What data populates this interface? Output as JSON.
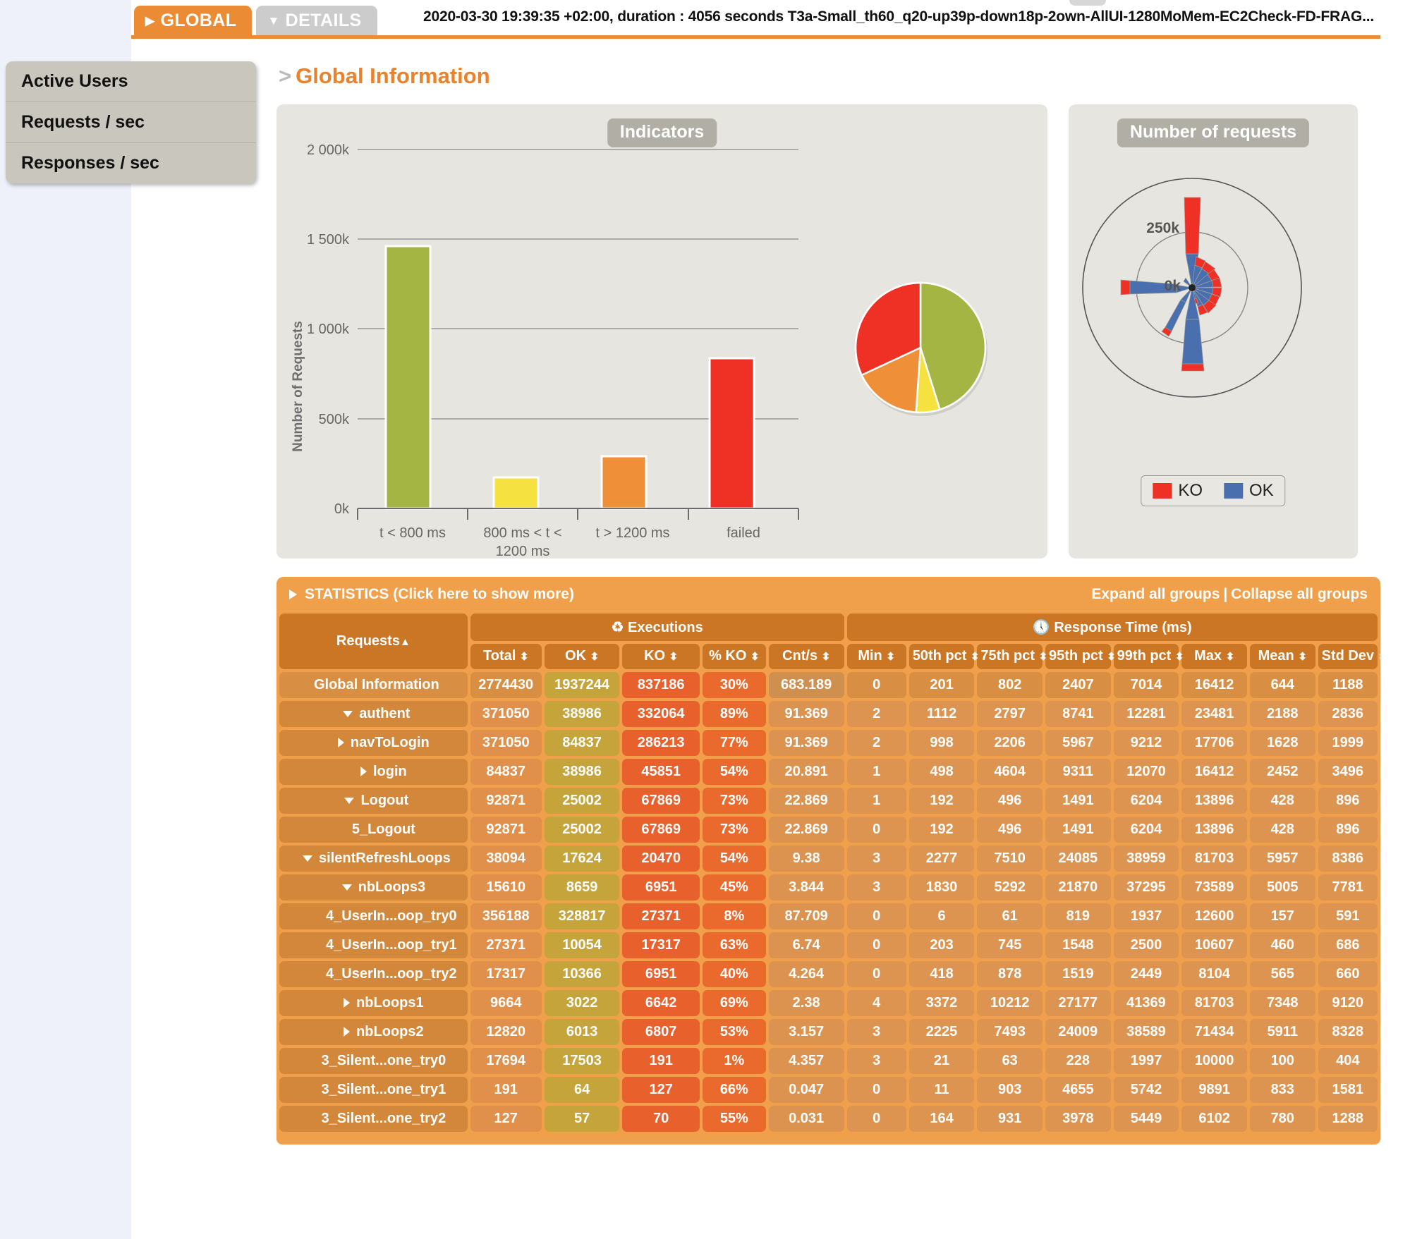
{
  "header": {
    "tabs": [
      {
        "label": "GLOBAL",
        "caret": "▶",
        "active": true
      },
      {
        "label": "DETAILS",
        "caret": "▼",
        "active": false
      }
    ],
    "run_title": "2020-03-30 19:39:35 +02:00, duration : 4056 seconds T3a-Small_th60_q20-up39p-down18p-2own-AllUI-1280MoMem-EC2Check-FD-FRAG..."
  },
  "sidebar": {
    "items": [
      {
        "label": "Active Users"
      },
      {
        "label": "Requests / sec"
      },
      {
        "label": "Responses / sec"
      }
    ]
  },
  "page": {
    "breadcrumb_arrow": ">",
    "title": "Global Information"
  },
  "chart_data": [
    {
      "type": "bar",
      "title": "Indicators",
      "xlabel": "",
      "ylabel": "Number of Requests",
      "categories": [
        "t < 800 ms",
        "800 ms < t < 1200 ms",
        "t > 1200 ms",
        "failed"
      ],
      "values": [
        1462000,
        172000,
        290000,
        837186
      ],
      "colors": [
        "#a4b544",
        "#f5e13f",
        "#ef9038",
        "#ee3124"
      ],
      "ylim": [
        0,
        2000000
      ],
      "yticks": [
        0,
        500000,
        1000000,
        1500000,
        2000000
      ],
      "ytick_labels": [
        "0k",
        "500k",
        "1 000k",
        "1 500k",
        "2 000k"
      ],
      "grid": true,
      "legend": ""
    },
    {
      "type": "pie",
      "title": "",
      "labels": [
        "t < 800 ms",
        "failed",
        "t > 1200 ms",
        "800 ms < t < 1200 ms"
      ],
      "values": [
        53,
        30,
        11,
        6
      ],
      "colors": [
        "#a4b544",
        "#ee3124",
        "#ef9038",
        "#f5e13f"
      ]
    },
    {
      "type": "polar",
      "title": "Number of requests",
      "rticks": [
        0,
        250000
      ],
      "rtick_labels": [
        "0k",
        "250k"
      ],
      "rlim": [
        0,
        500000
      ],
      "legend": [
        "KO",
        "OK"
      ],
      "legend_colors": [
        "#ee3124",
        "#4a6fae"
      ],
      "legend_position": "bottom",
      "series": [
        {
          "name": "OK",
          "color": "#4a6fae",
          "values": [
            12000,
            40000,
            38000,
            36000,
            34000,
            32000,
            30000,
            26000,
            18000,
            9000,
            6000,
            52000,
            140000,
            52000,
            32000,
            20000,
            18000,
            110000,
            14000,
            9000,
            7000,
            6000,
            5000,
            8000
          ]
        },
        {
          "name": "KO",
          "color": "#ee3124",
          "values": [
            4000,
            12000,
            12000,
            12000,
            12000,
            12000,
            12000,
            10000,
            6000,
            3000,
            2000,
            18000,
            195000,
            12000,
            10000,
            8000,
            7000,
            26000,
            5000,
            4000,
            3000,
            3000,
            2000,
            4000
          ]
        }
      ]
    }
  ],
  "statistics": {
    "header_label": "STATISTICS (Click here to show more)",
    "expand_label": "Expand all groups",
    "separator": "|",
    "collapse_label": "Collapse all groups",
    "group_headers": [
      {
        "label": "Executions",
        "icon": "refresh-icon"
      },
      {
        "label": "Response Time (ms)",
        "icon": "clock-icon"
      }
    ],
    "columns": {
      "requests": "Requests",
      "requests_sort": "▲",
      "executions": [
        "Total",
        "OK",
        "KO",
        "% KO",
        "Cnt/s"
      ],
      "response_time": [
        "Min",
        "50th pct",
        "75th pct",
        "95th pct",
        "99th pct",
        "Max",
        "Mean",
        "Std Dev"
      ],
      "sort_glyph": "⬍"
    },
    "rows": [
      {
        "name": "Global Information",
        "indent": 0,
        "toggle": "none",
        "global": true,
        "total": "2774430",
        "ok": "1937244",
        "ko": "837186",
        "pko": "30%",
        "cnt": "683.189",
        "min": "0",
        "p50": "201",
        "p75": "802",
        "p95": "2407",
        "p99": "7014",
        "max": "16412",
        "mean": "644",
        "std": "1188"
      },
      {
        "name": "authent",
        "indent": 0,
        "toggle": "down",
        "total": "371050",
        "ok": "38986",
        "ko": "332064",
        "pko": "89%",
        "cnt": "91.369",
        "min": "2",
        "p50": "1112",
        "p75": "2797",
        "p95": "8741",
        "p99": "12281",
        "max": "23481",
        "mean": "2188",
        "std": "2836"
      },
      {
        "name": "navToLogin",
        "indent": 1,
        "toggle": "right",
        "total": "371050",
        "ok": "84837",
        "ko": "286213",
        "pko": "77%",
        "cnt": "91.369",
        "min": "2",
        "p50": "998",
        "p75": "2206",
        "p95": "5967",
        "p99": "9212",
        "max": "17706",
        "mean": "1628",
        "std": "1999"
      },
      {
        "name": "login",
        "indent": 1,
        "toggle": "right",
        "total": "84837",
        "ok": "38986",
        "ko": "45851",
        "pko": "54%",
        "cnt": "20.891",
        "min": "1",
        "p50": "498",
        "p75": "4604",
        "p95": "9311",
        "p99": "12070",
        "max": "16412",
        "mean": "2452",
        "std": "3496"
      },
      {
        "name": "Logout",
        "indent": 0,
        "toggle": "down",
        "total": "92871",
        "ok": "25002",
        "ko": "67869",
        "pko": "73%",
        "cnt": "22.869",
        "min": "1",
        "p50": "192",
        "p75": "496",
        "p95": "1491",
        "p99": "6204",
        "max": "13896",
        "mean": "428",
        "std": "896"
      },
      {
        "name": "5_Logout",
        "indent": 1,
        "toggle": "none",
        "total": "92871",
        "ok": "25002",
        "ko": "67869",
        "pko": "73%",
        "cnt": "22.869",
        "min": "0",
        "p50": "192",
        "p75": "496",
        "p95": "1491",
        "p99": "6204",
        "max": "13896",
        "mean": "428",
        "std": "896"
      },
      {
        "name": "silentRefreshLoops",
        "indent": 0,
        "toggle": "down",
        "total": "38094",
        "ok": "17624",
        "ko": "20470",
        "pko": "54%",
        "cnt": "9.38",
        "min": "3",
        "p50": "2277",
        "p75": "7510",
        "p95": "24085",
        "p99": "38959",
        "max": "81703",
        "mean": "5957",
        "std": "8386"
      },
      {
        "name": "nbLoops3",
        "indent": 1,
        "toggle": "down",
        "total": "15610",
        "ok": "8659",
        "ko": "6951",
        "pko": "45%",
        "cnt": "3.844",
        "min": "3",
        "p50": "1830",
        "p75": "5292",
        "p95": "21870",
        "p99": "37295",
        "max": "73589",
        "mean": "5005",
        "std": "7781"
      },
      {
        "name": "4_UserIn...oop_try0",
        "indent": 2,
        "toggle": "none",
        "total": "356188",
        "ok": "328817",
        "ko": "27371",
        "pko": "8%",
        "cnt": "87.709",
        "min": "0",
        "p50": "6",
        "p75": "61",
        "p95": "819",
        "p99": "1937",
        "max": "12600",
        "mean": "157",
        "std": "591"
      },
      {
        "name": "4_UserIn...oop_try1",
        "indent": 2,
        "toggle": "none",
        "total": "27371",
        "ok": "10054",
        "ko": "17317",
        "pko": "63%",
        "cnt": "6.74",
        "min": "0",
        "p50": "203",
        "p75": "745",
        "p95": "1548",
        "p99": "2500",
        "max": "10607",
        "mean": "460",
        "std": "686"
      },
      {
        "name": "4_UserIn...oop_try2",
        "indent": 2,
        "toggle": "none",
        "total": "17317",
        "ok": "10366",
        "ko": "6951",
        "pko": "40%",
        "cnt": "4.264",
        "min": "0",
        "p50": "418",
        "p75": "878",
        "p95": "1519",
        "p99": "2449",
        "max": "8104",
        "mean": "565",
        "std": "660"
      },
      {
        "name": "nbLoops1",
        "indent": 1,
        "toggle": "right",
        "total": "9664",
        "ok": "3022",
        "ko": "6642",
        "pko": "69%",
        "cnt": "2.38",
        "min": "4",
        "p50": "3372",
        "p75": "10212",
        "p95": "27177",
        "p99": "41369",
        "max": "81703",
        "mean": "7348",
        "std": "9120"
      },
      {
        "name": "nbLoops2",
        "indent": 1,
        "toggle": "right",
        "total": "12820",
        "ok": "6013",
        "ko": "6807",
        "pko": "53%",
        "cnt": "3.157",
        "min": "3",
        "p50": "2225",
        "p75": "7493",
        "p95": "24009",
        "p99": "38589",
        "max": "71434",
        "mean": "5911",
        "std": "8328"
      },
      {
        "name": "3_Silent...one_try0",
        "indent": 1,
        "toggle": "none",
        "total": "17694",
        "ok": "17503",
        "ko": "191",
        "pko": "1%",
        "cnt": "4.357",
        "min": "3",
        "p50": "21",
        "p75": "63",
        "p95": "228",
        "p99": "1997",
        "max": "10000",
        "mean": "100",
        "std": "404"
      },
      {
        "name": "3_Silent...one_try1",
        "indent": 1,
        "toggle": "none",
        "total": "191",
        "ok": "64",
        "ko": "127",
        "pko": "66%",
        "cnt": "0.047",
        "min": "0",
        "p50": "11",
        "p75": "903",
        "p95": "4655",
        "p99": "5742",
        "max": "9891",
        "mean": "833",
        "std": "1581"
      },
      {
        "name": "3_Silent...one_try2",
        "indent": 1,
        "toggle": "none",
        "total": "127",
        "ok": "57",
        "ko": "70",
        "pko": "55%",
        "cnt": "0.031",
        "min": "0",
        "p50": "164",
        "p75": "931",
        "p95": "3978",
        "p99": "5449",
        "max": "6102",
        "mean": "780",
        "std": "1288"
      }
    ]
  },
  "colors": {
    "accent": "#eb8c35",
    "green": "#a4b544",
    "yellow": "#f5e13f",
    "orange": "#ef9038",
    "red": "#ee3124",
    "blue": "#4a6fae"
  }
}
